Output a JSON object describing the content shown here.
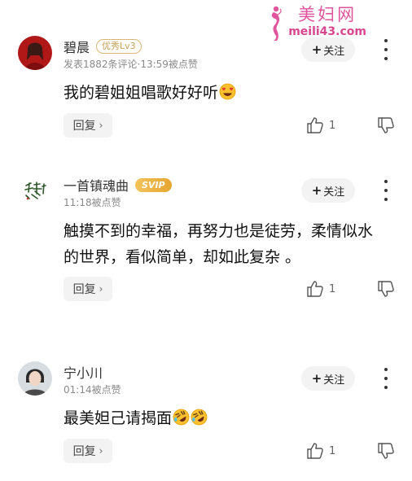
{
  "watermark": {
    "title": "美妇网",
    "url": "meili43.com"
  },
  "comments": [
    {
      "name": "碧晨",
      "badge": "优秀Lv3",
      "meta": "发表1882条评论·13:59被点赞",
      "follow_label": "关注",
      "text": "我的碧姐姐唱歌好好听",
      "emojis": [
        "heart-eyes-emoji"
      ],
      "reply_label": "回复",
      "like_count": "1"
    },
    {
      "name": "一首镇魂曲",
      "badge": "SVIP",
      "meta": "11:18被点赞",
      "follow_label": "关注",
      "text_line1": "触摸不到的幸福，再努力也是徒劳，柔情似水",
      "text_line2": "的世界，看似简单，却如此复杂 。",
      "reply_label": "回复",
      "like_count": "1"
    },
    {
      "name": "宁小川",
      "meta": "01:14被点赞",
      "follow_label": "关注",
      "text": "最美妲己请揭面",
      "emojis": [
        "rolling-laughing-emoji",
        "rolling-laughing-emoji"
      ],
      "reply_label": "回复",
      "like_count": "1"
    }
  ],
  "colors": {
    "badge_gold": "#c8a25a",
    "svip_gold": "#e6a531",
    "watermark_pink": "#e0559c"
  }
}
